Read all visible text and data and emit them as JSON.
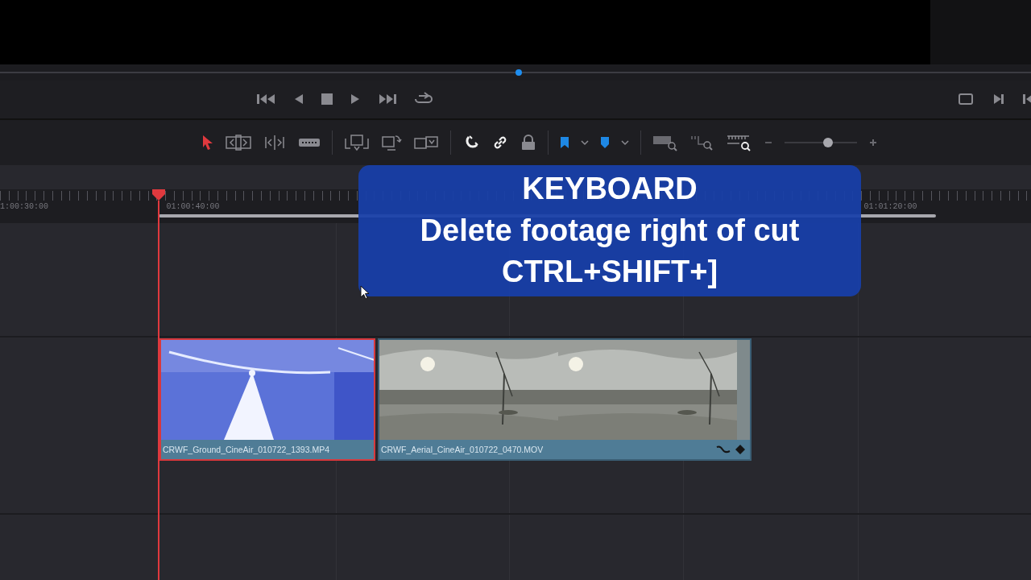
{
  "scrubber": {
    "level": 0.503
  },
  "toolbar": {
    "tools": [
      {
        "kind": "select",
        "selected": true
      },
      {
        "kind": "trim",
        "selected": false
      },
      {
        "kind": "dynamic-trim",
        "selected": false
      },
      {
        "kind": "blade",
        "selected": false
      }
    ],
    "snapping": {
      "on": true
    },
    "linked_selection": {
      "on": true
    },
    "position_lock": {
      "on": false
    },
    "zoom": {
      "level": 0.6
    }
  },
  "ruler": {
    "timecodes": [
      "1:00:30:00",
      "01:00:40:00",
      "01:01:20:00"
    ]
  },
  "clips": [
    {
      "name": "CRWF_Ground_CineAir_010722_1393.MP4",
      "selected": true,
      "kind": "picture"
    },
    {
      "name": "CRWF_Aerial_CineAir_010722_0470.MOV",
      "selected": false,
      "kind": "picture"
    }
  ],
  "caption": {
    "lines": [
      "KEYBOARD",
      "Delete footage right of cut",
      "CTRL+SHIFT+]"
    ]
  }
}
